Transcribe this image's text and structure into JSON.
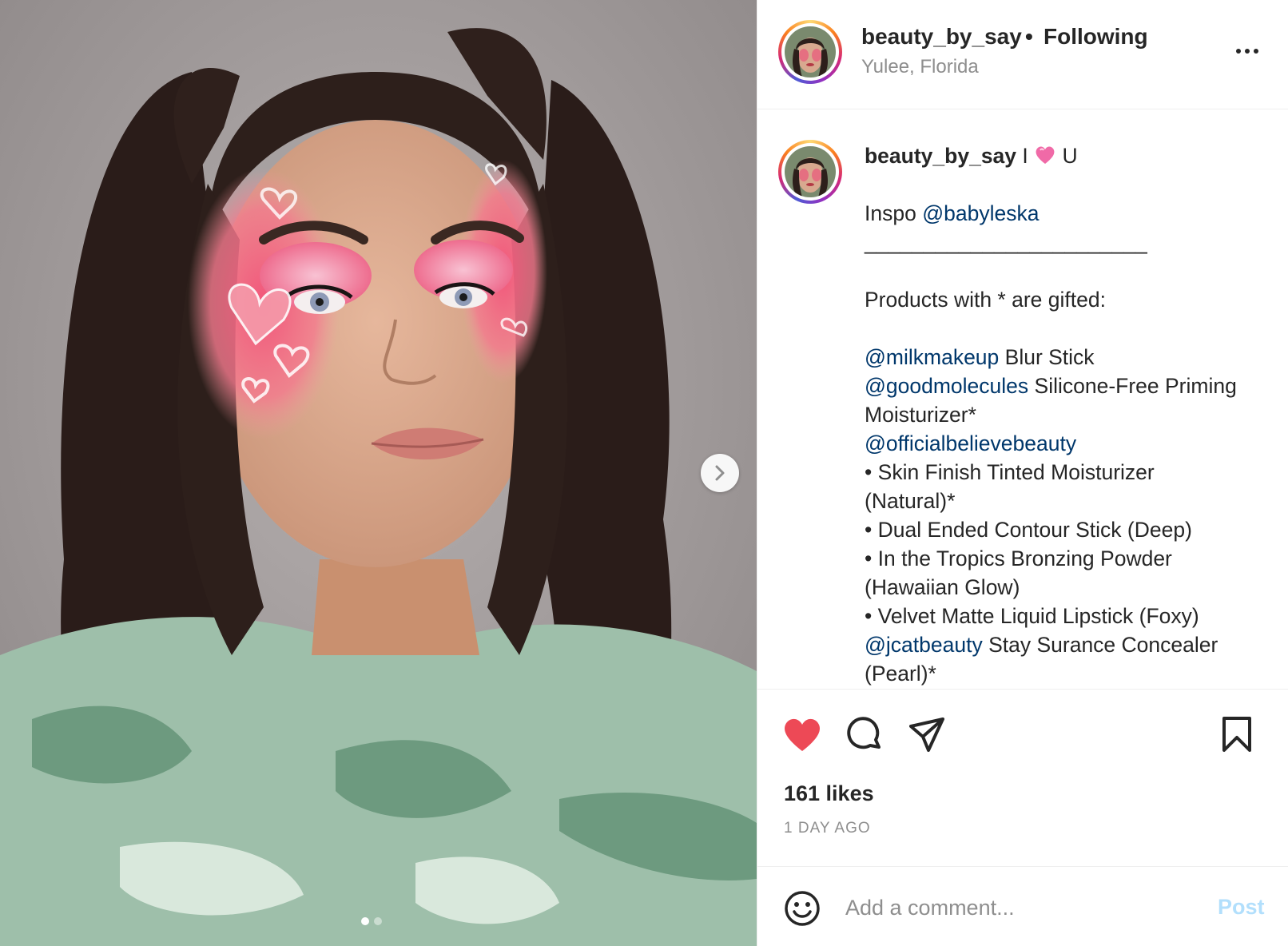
{
  "post": {
    "username": "beauty_by_say",
    "separator": "•",
    "follow_status": "Following",
    "location": "Yulee, Florida",
    "more_icon": "more-horizontal-icon"
  },
  "carousel": {
    "total_slides": 2,
    "current_slide": 1,
    "next_icon": "chevron-right-icon"
  },
  "caption": {
    "username": "beauty_by_say",
    "title_prefix": "I",
    "title_emoji": "pink-heart-emoji",
    "title_suffix": "U",
    "inspo_label": "Inspo",
    "inspo_mention": "@babyleska",
    "divider": "________________________",
    "gifted_note": "Products with * are gifted:",
    "lines": [
      {
        "mention": "@milkmakeup",
        "text": " Blur Stick"
      },
      {
        "mention": "@goodmolecules",
        "text": " Silicone-Free Priming"
      },
      {
        "mention": "",
        "text": "Moisturizer*"
      },
      {
        "mention": "@officialbelievebeauty",
        "text": ""
      },
      {
        "mention": "",
        "text": "• Skin Finish Tinted Moisturizer"
      },
      {
        "mention": "",
        "text": "(Natural)*"
      },
      {
        "mention": "",
        "text": "• Dual Ended Contour Stick (Deep)"
      },
      {
        "mention": "",
        "text": "• In the Tropics Bronzing Powder"
      },
      {
        "mention": "",
        "text": "(Hawaiian Glow)"
      },
      {
        "mention": "",
        "text": "• Velvet Matte Liquid Lipstick (Foxy)"
      },
      {
        "mention": "@jcatbeauty",
        "text": " Stay Surance Concealer"
      },
      {
        "mention": "",
        "text": "(Pearl)*"
      }
    ]
  },
  "actions": {
    "like_icon": "heart-filled-icon",
    "comment_icon": "comment-icon",
    "share_icon": "paper-plane-icon",
    "save_icon": "bookmark-icon",
    "like_color": "#ed4956"
  },
  "stats": {
    "likes": "161 likes",
    "time": "1 DAY AGO"
  },
  "comment": {
    "placeholder": "Add a comment...",
    "post_label": "Post",
    "emoji_icon": "smiley-icon",
    "post_color": "#b2dffc"
  }
}
